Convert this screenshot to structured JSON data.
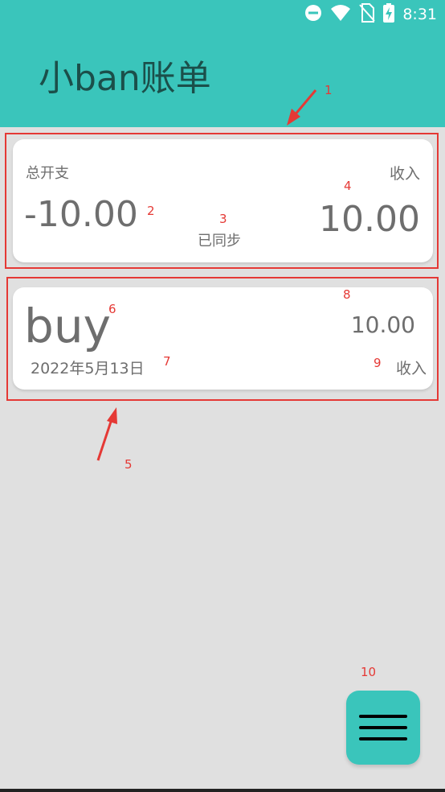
{
  "status_bar": {
    "time": "8:31",
    "icons": [
      "do-not-disturb-icon",
      "wifi-icon",
      "no-sim-icon",
      "battery-charging-icon"
    ]
  },
  "app_bar": {
    "title": "小ban账单"
  },
  "summary": {
    "label_total": "总开支",
    "total_value": "-10.00",
    "sync_status": "已同步",
    "label_income": "收入",
    "income_value": "10.00"
  },
  "entries": [
    {
      "name": "buy",
      "date": "2022年5月13日",
      "amount": "10.00",
      "type": "收入"
    }
  ],
  "annotations": [
    "1",
    "2",
    "3",
    "4",
    "5",
    "6",
    "7",
    "8",
    "9",
    "10"
  ],
  "colors": {
    "accent": "#3ac5bb",
    "title_text": "#1b4f4a",
    "annotation": "#e53935",
    "background": "#e0e0e0"
  },
  "fab": {
    "icon": "menu-icon"
  }
}
